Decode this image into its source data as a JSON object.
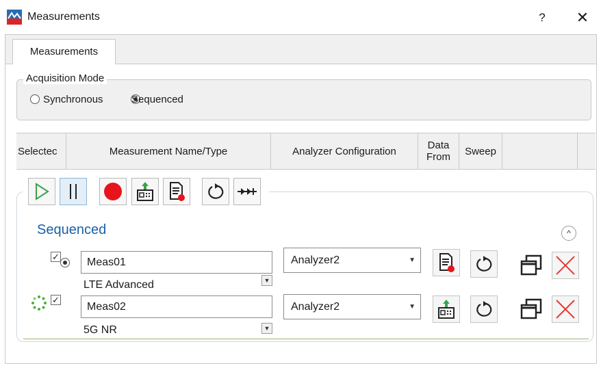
{
  "window": {
    "title": "Measurements",
    "help_label": "?",
    "close_label": "✕"
  },
  "tabs": [
    {
      "label": "Measurements"
    }
  ],
  "acquisition": {
    "title": "Acquisition Mode",
    "options": [
      {
        "label": "Synchronous",
        "selected": false
      },
      {
        "label": "Sequenced",
        "selected": true
      }
    ]
  },
  "table": {
    "columns": [
      "Selectec",
      "Measurement Name/Type",
      "Analyzer Configuration",
      "Data From",
      "Sweep"
    ]
  },
  "toolbar": {
    "buttons": [
      {
        "icon": "play-icon"
      },
      {
        "icon": "pause-icon"
      },
      {
        "icon": "record-icon"
      },
      {
        "icon": "upload-data-icon"
      },
      {
        "icon": "document-record-icon"
      },
      {
        "icon": "sweep-icon"
      },
      {
        "icon": "step-icon"
      }
    ]
  },
  "sequence": {
    "title": "Sequenced",
    "collapse_glyph": "^",
    "rows": [
      {
        "name": "Meas01",
        "type": "LTE Advanced",
        "analyzer": "Analyzer2",
        "checked": true,
        "status_icon": "radio-selected-icon",
        "data_from_icon": "document-record-icon"
      },
      {
        "name": "Meas02",
        "type": "5G NR",
        "analyzer": "Analyzer2",
        "checked": true,
        "status_icon": "busy-spinner-icon",
        "data_from_icon": "upload-data-icon"
      }
    ]
  },
  "colors": {
    "accent": "#1b5fa8",
    "record": "#e8141c",
    "play": "#3aa24a",
    "delete": "#e53b3b"
  }
}
